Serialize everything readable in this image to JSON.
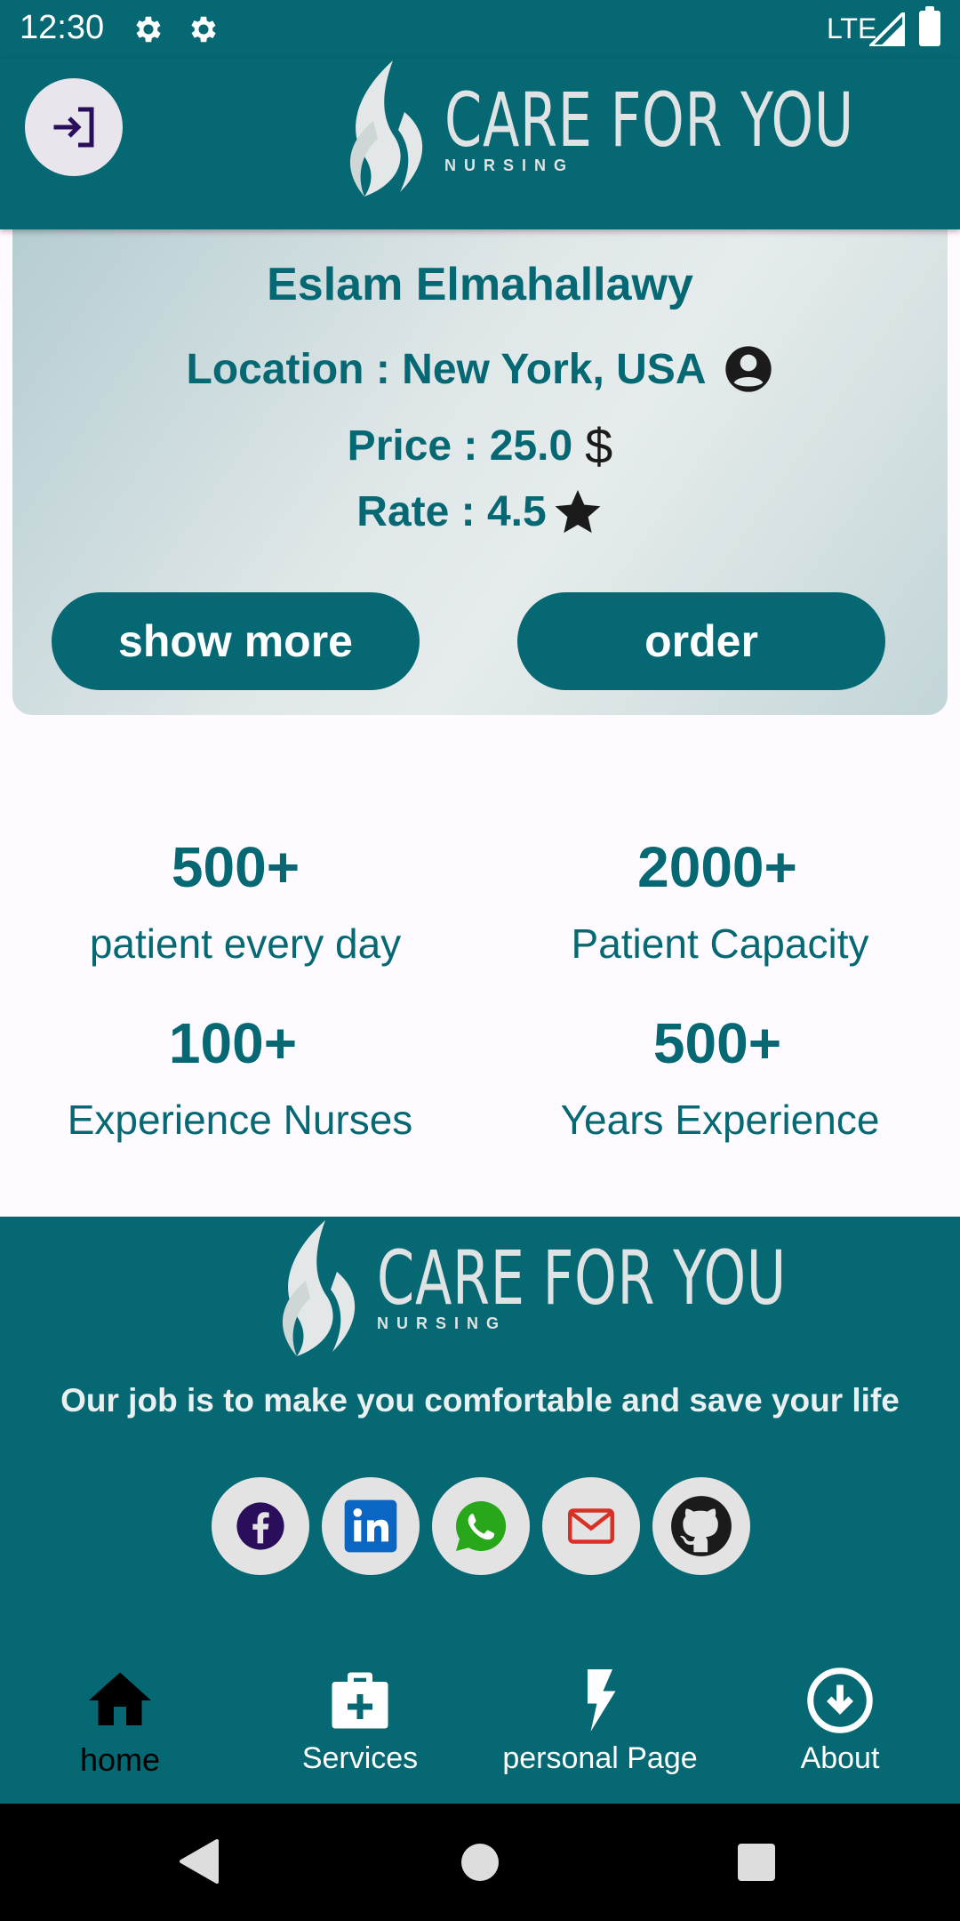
{
  "status_bar": {
    "time": "12:30",
    "network": "LTE"
  },
  "header": {
    "logo": {
      "title": "CARE FOR YOU",
      "subtitle": "NURSING"
    },
    "icons": {
      "login": "login-icon"
    }
  },
  "nurse_card": {
    "name": "Eslam Elmahallawy",
    "location_text": "Location : New York, USA",
    "price_text": "Price : 25.0",
    "price_symbol": "$",
    "rate_text": "Rate : 4.5",
    "show_more_label": "show more",
    "order_label": "order"
  },
  "stats": [
    {
      "value": "500+",
      "label": "patient every day"
    },
    {
      "value": "2000+",
      "label": "Patient Capacity"
    },
    {
      "value": "100+",
      "label": "Experience Nurses"
    },
    {
      "value": "500+",
      "label": "Years Experience"
    }
  ],
  "footer": {
    "logo": {
      "title": "CARE FOR YOU",
      "subtitle": "NURSING"
    },
    "tagline": "Our job is to make you comfortable and save your life",
    "socials": [
      "facebook-icon",
      "linkedin-icon",
      "whatsapp-icon",
      "email-icon",
      "github-icon"
    ]
  },
  "bottom_nav": [
    {
      "label": "home",
      "icon": "home-icon",
      "active": true
    },
    {
      "label": "Services",
      "icon": "medical-bag-icon",
      "active": false
    },
    {
      "label": "personal Page",
      "icon": "flash-icon",
      "active": false
    },
    {
      "label": "About",
      "icon": "download-circle-icon",
      "active": false
    }
  ],
  "colors": {
    "primary": "#056873",
    "surface": "#fdfbff",
    "active_nav": "#000000"
  }
}
